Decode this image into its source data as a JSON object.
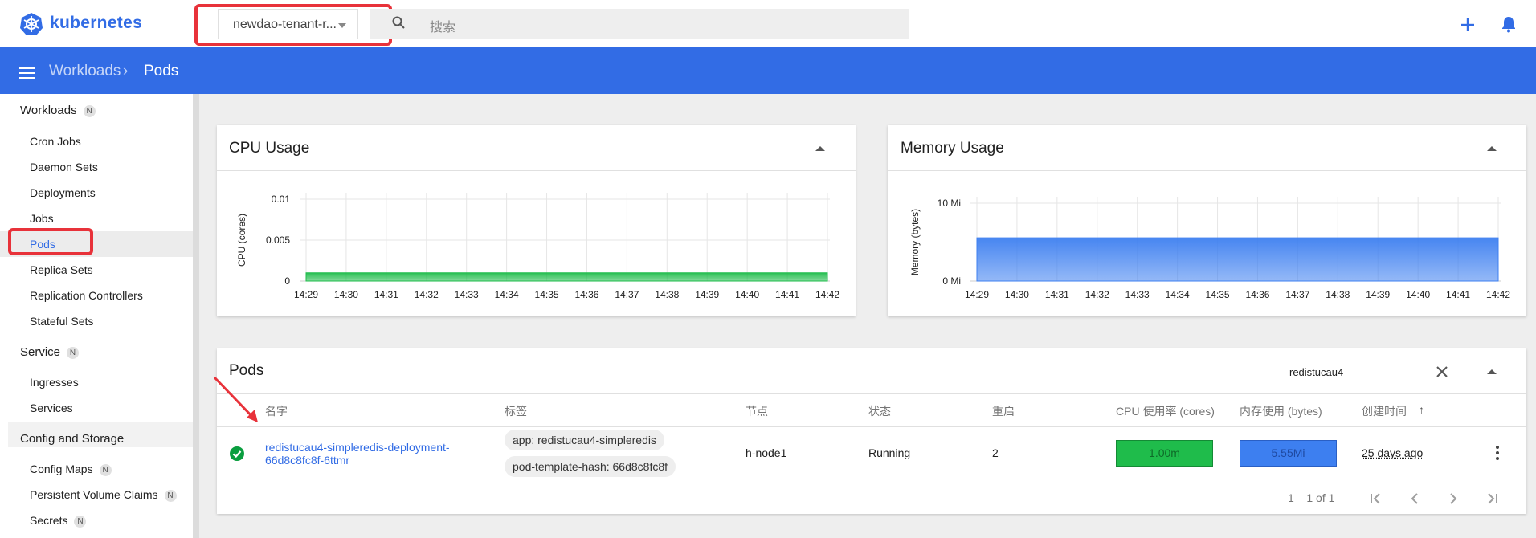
{
  "header": {
    "app_name": "kubernetes",
    "namespace": "newdao-tenant-r...",
    "search_placeholder": "搜索"
  },
  "breadcrumb": {
    "parent": "Workloads",
    "separator": "›",
    "current": "Pods"
  },
  "sidebar": {
    "sections": [
      {
        "label": "Workloads",
        "badge": "N"
      },
      {
        "label": "Service",
        "badge": "N"
      },
      {
        "label": "Config and Storage"
      }
    ],
    "workload_items": [
      "Cron Jobs",
      "Daemon Sets",
      "Deployments",
      "Jobs",
      "Pods",
      "Replica Sets",
      "Replication Controllers",
      "Stateful Sets"
    ],
    "service_items": [
      "Ingresses",
      "Services"
    ],
    "config_items": [
      {
        "label": "Config Maps",
        "badge": "N"
      },
      {
        "label": "Persistent Volume Claims",
        "badge": "N"
      },
      {
        "label": "Secrets",
        "badge": "N"
      }
    ],
    "active_item": "Pods"
  },
  "cards": {
    "cpu_title": "CPU Usage",
    "memory_title": "Memory Usage",
    "pods_title": "Pods"
  },
  "chart_data": [
    {
      "type": "area",
      "title": "CPU Usage",
      "ylabel": "CPU (cores)",
      "x": [
        "14:29",
        "14:30",
        "14:31",
        "14:32",
        "14:33",
        "14:34",
        "14:35",
        "14:36",
        "14:37",
        "14:38",
        "14:39",
        "14:40",
        "14:41",
        "14:42"
      ],
      "yticks": [
        "0",
        "0.005",
        "0.01"
      ],
      "ylim": [
        0,
        0.01
      ],
      "series": [
        {
          "values": [
            0.001,
            0.001,
            0.001,
            0.001,
            0.001,
            0.001,
            0.001,
            0.001,
            0.001,
            0.001,
            0.001,
            0.001,
            0.001,
            0.001
          ]
        }
      ],
      "color": "#1fbc4b",
      "grid": true
    },
    {
      "type": "area",
      "title": "Memory Usage",
      "ylabel": "Memory (bytes)",
      "x": [
        "14:29",
        "14:30",
        "14:31",
        "14:32",
        "14:33",
        "14:34",
        "14:35",
        "14:36",
        "14:37",
        "14:38",
        "14:39",
        "14:40",
        "14:41",
        "14:42"
      ],
      "yticks": [
        "0 Mi",
        "10 Mi"
      ],
      "ylim_mi": [
        0,
        10
      ],
      "series": [
        {
          "values_mi": [
            5.55,
            5.55,
            5.55,
            5.55,
            5.55,
            5.55,
            5.55,
            5.55,
            5.55,
            5.55,
            5.55,
            5.55,
            5.55,
            5.55
          ]
        }
      ],
      "color": "#3d7ff0",
      "grid": true
    }
  ],
  "pods_table": {
    "filter_value": "redistucau4",
    "columns": [
      "名字",
      "标签",
      "节点",
      "状态",
      "重启",
      "CPU 使用率 (cores)",
      "内存使用 (bytes)",
      "创建时间"
    ],
    "sort_indicator": "↑",
    "rows": [
      {
        "name": "redistucau4-simpleredis-deployment-66d8c8fc8f-6ttmr",
        "labels": [
          "app: redistucau4-simpleredis",
          "pod-template-hash: 66d8c8fc8f"
        ],
        "node": "h-node1",
        "status": "Running",
        "restarts": "2",
        "cpu": "1.00m",
        "memory": "5.55Mi",
        "created": "25 days ago"
      }
    ],
    "pagination": "1 – 1 of 1"
  }
}
